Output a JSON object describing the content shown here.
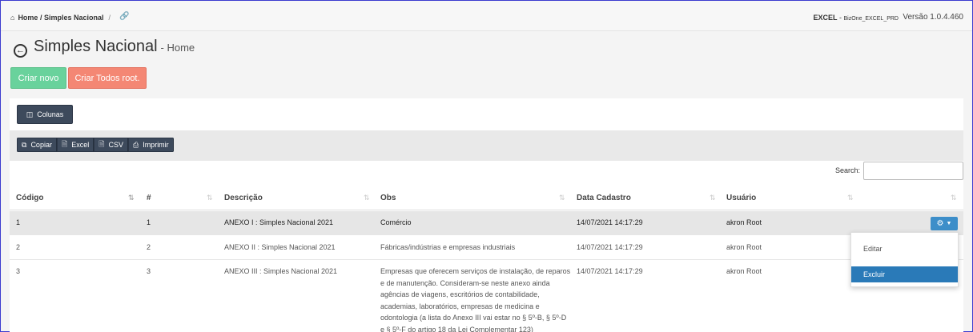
{
  "topbar": {
    "breadcrumb": "Home / Simples Nacional",
    "breadcrumb_sep": "/",
    "env_name": "EXCEL",
    "env_code": "BizOne_EXCEL_PRD",
    "version": "Versão 1.0.4.460"
  },
  "header": {
    "title": "Simples Nacional",
    "subtitle": "- Home"
  },
  "actions": {
    "novo": "Criar novo",
    "todos": "Criar Todos root."
  },
  "toolbar": {
    "colunas": "Colunas",
    "copiar": "Copiar",
    "excel": "Excel",
    "csv": "CSV",
    "imprimir": "Imprimir",
    "search_label": "Search:",
    "search_value": ""
  },
  "table": {
    "headers": [
      "Código",
      "#",
      "Descrição",
      "Obs",
      "Data Cadastro",
      "Usuário"
    ],
    "rows": [
      {
        "codigo": "1",
        "num": "1",
        "descricao": "ANEXO I : Simples Nacional 2021",
        "obs": "Comércio",
        "data": "14/07/2021 14:17:29",
        "usuario": "akron Root"
      },
      {
        "codigo": "2",
        "num": "2",
        "descricao": "ANEXO II : Simples Nacional 2021",
        "obs": "Fábricas/indústrias e empresas industriais",
        "data": "14/07/2021 14:17:29",
        "usuario": "akron Root"
      },
      {
        "codigo": "3",
        "num": "3",
        "descricao": "ANEXO III : Simples Nacional 2021",
        "obs": "Empresas que oferecem serviços de instalação, de reparos e de manutenção. Consideram-se neste anexo ainda agências de viagens, escritórios de contabilidade, academias, laboratórios, empresas de medicina e odontologia (a lista do Anexo III vai estar no § 5º-B, § 5º-D e § 5º-F do artigo 18 da Lei Complementar 123)",
        "data": "14/07/2021 14:17:29",
        "usuario": "akron Root"
      }
    ]
  },
  "dropdown": {
    "editar": "Editar",
    "excluir": "Excluir"
  }
}
